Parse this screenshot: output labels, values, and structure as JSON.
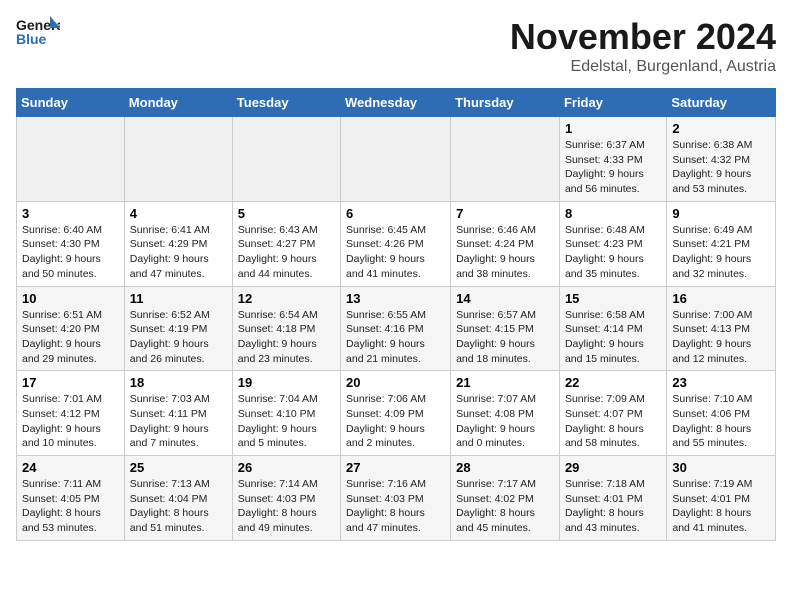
{
  "header": {
    "logo_line1": "General",
    "logo_line2": "Blue",
    "month": "November 2024",
    "location": "Edelstal, Burgenland, Austria"
  },
  "days_of_week": [
    "Sunday",
    "Monday",
    "Tuesday",
    "Wednesday",
    "Thursday",
    "Friday",
    "Saturday"
  ],
  "weeks": [
    [
      {
        "day": "",
        "info": ""
      },
      {
        "day": "",
        "info": ""
      },
      {
        "day": "",
        "info": ""
      },
      {
        "day": "",
        "info": ""
      },
      {
        "day": "",
        "info": ""
      },
      {
        "day": "1",
        "info": "Sunrise: 6:37 AM\nSunset: 4:33 PM\nDaylight: 9 hours and 56 minutes."
      },
      {
        "day": "2",
        "info": "Sunrise: 6:38 AM\nSunset: 4:32 PM\nDaylight: 9 hours and 53 minutes."
      }
    ],
    [
      {
        "day": "3",
        "info": "Sunrise: 6:40 AM\nSunset: 4:30 PM\nDaylight: 9 hours and 50 minutes."
      },
      {
        "day": "4",
        "info": "Sunrise: 6:41 AM\nSunset: 4:29 PM\nDaylight: 9 hours and 47 minutes."
      },
      {
        "day": "5",
        "info": "Sunrise: 6:43 AM\nSunset: 4:27 PM\nDaylight: 9 hours and 44 minutes."
      },
      {
        "day": "6",
        "info": "Sunrise: 6:45 AM\nSunset: 4:26 PM\nDaylight: 9 hours and 41 minutes."
      },
      {
        "day": "7",
        "info": "Sunrise: 6:46 AM\nSunset: 4:24 PM\nDaylight: 9 hours and 38 minutes."
      },
      {
        "day": "8",
        "info": "Sunrise: 6:48 AM\nSunset: 4:23 PM\nDaylight: 9 hours and 35 minutes."
      },
      {
        "day": "9",
        "info": "Sunrise: 6:49 AM\nSunset: 4:21 PM\nDaylight: 9 hours and 32 minutes."
      }
    ],
    [
      {
        "day": "10",
        "info": "Sunrise: 6:51 AM\nSunset: 4:20 PM\nDaylight: 9 hours and 29 minutes."
      },
      {
        "day": "11",
        "info": "Sunrise: 6:52 AM\nSunset: 4:19 PM\nDaylight: 9 hours and 26 minutes."
      },
      {
        "day": "12",
        "info": "Sunrise: 6:54 AM\nSunset: 4:18 PM\nDaylight: 9 hours and 23 minutes."
      },
      {
        "day": "13",
        "info": "Sunrise: 6:55 AM\nSunset: 4:16 PM\nDaylight: 9 hours and 21 minutes."
      },
      {
        "day": "14",
        "info": "Sunrise: 6:57 AM\nSunset: 4:15 PM\nDaylight: 9 hours and 18 minutes."
      },
      {
        "day": "15",
        "info": "Sunrise: 6:58 AM\nSunset: 4:14 PM\nDaylight: 9 hours and 15 minutes."
      },
      {
        "day": "16",
        "info": "Sunrise: 7:00 AM\nSunset: 4:13 PM\nDaylight: 9 hours and 12 minutes."
      }
    ],
    [
      {
        "day": "17",
        "info": "Sunrise: 7:01 AM\nSunset: 4:12 PM\nDaylight: 9 hours and 10 minutes."
      },
      {
        "day": "18",
        "info": "Sunrise: 7:03 AM\nSunset: 4:11 PM\nDaylight: 9 hours and 7 minutes."
      },
      {
        "day": "19",
        "info": "Sunrise: 7:04 AM\nSunset: 4:10 PM\nDaylight: 9 hours and 5 minutes."
      },
      {
        "day": "20",
        "info": "Sunrise: 7:06 AM\nSunset: 4:09 PM\nDaylight: 9 hours and 2 minutes."
      },
      {
        "day": "21",
        "info": "Sunrise: 7:07 AM\nSunset: 4:08 PM\nDaylight: 9 hours and 0 minutes."
      },
      {
        "day": "22",
        "info": "Sunrise: 7:09 AM\nSunset: 4:07 PM\nDaylight: 8 hours and 58 minutes."
      },
      {
        "day": "23",
        "info": "Sunrise: 7:10 AM\nSunset: 4:06 PM\nDaylight: 8 hours and 55 minutes."
      }
    ],
    [
      {
        "day": "24",
        "info": "Sunrise: 7:11 AM\nSunset: 4:05 PM\nDaylight: 8 hours and 53 minutes."
      },
      {
        "day": "25",
        "info": "Sunrise: 7:13 AM\nSunset: 4:04 PM\nDaylight: 8 hours and 51 minutes."
      },
      {
        "day": "26",
        "info": "Sunrise: 7:14 AM\nSunset: 4:03 PM\nDaylight: 8 hours and 49 minutes."
      },
      {
        "day": "27",
        "info": "Sunrise: 7:16 AM\nSunset: 4:03 PM\nDaylight: 8 hours and 47 minutes."
      },
      {
        "day": "28",
        "info": "Sunrise: 7:17 AM\nSunset: 4:02 PM\nDaylight: 8 hours and 45 minutes."
      },
      {
        "day": "29",
        "info": "Sunrise: 7:18 AM\nSunset: 4:01 PM\nDaylight: 8 hours and 43 minutes."
      },
      {
        "day": "30",
        "info": "Sunrise: 7:19 AM\nSunset: 4:01 PM\nDaylight: 8 hours and 41 minutes."
      }
    ]
  ]
}
